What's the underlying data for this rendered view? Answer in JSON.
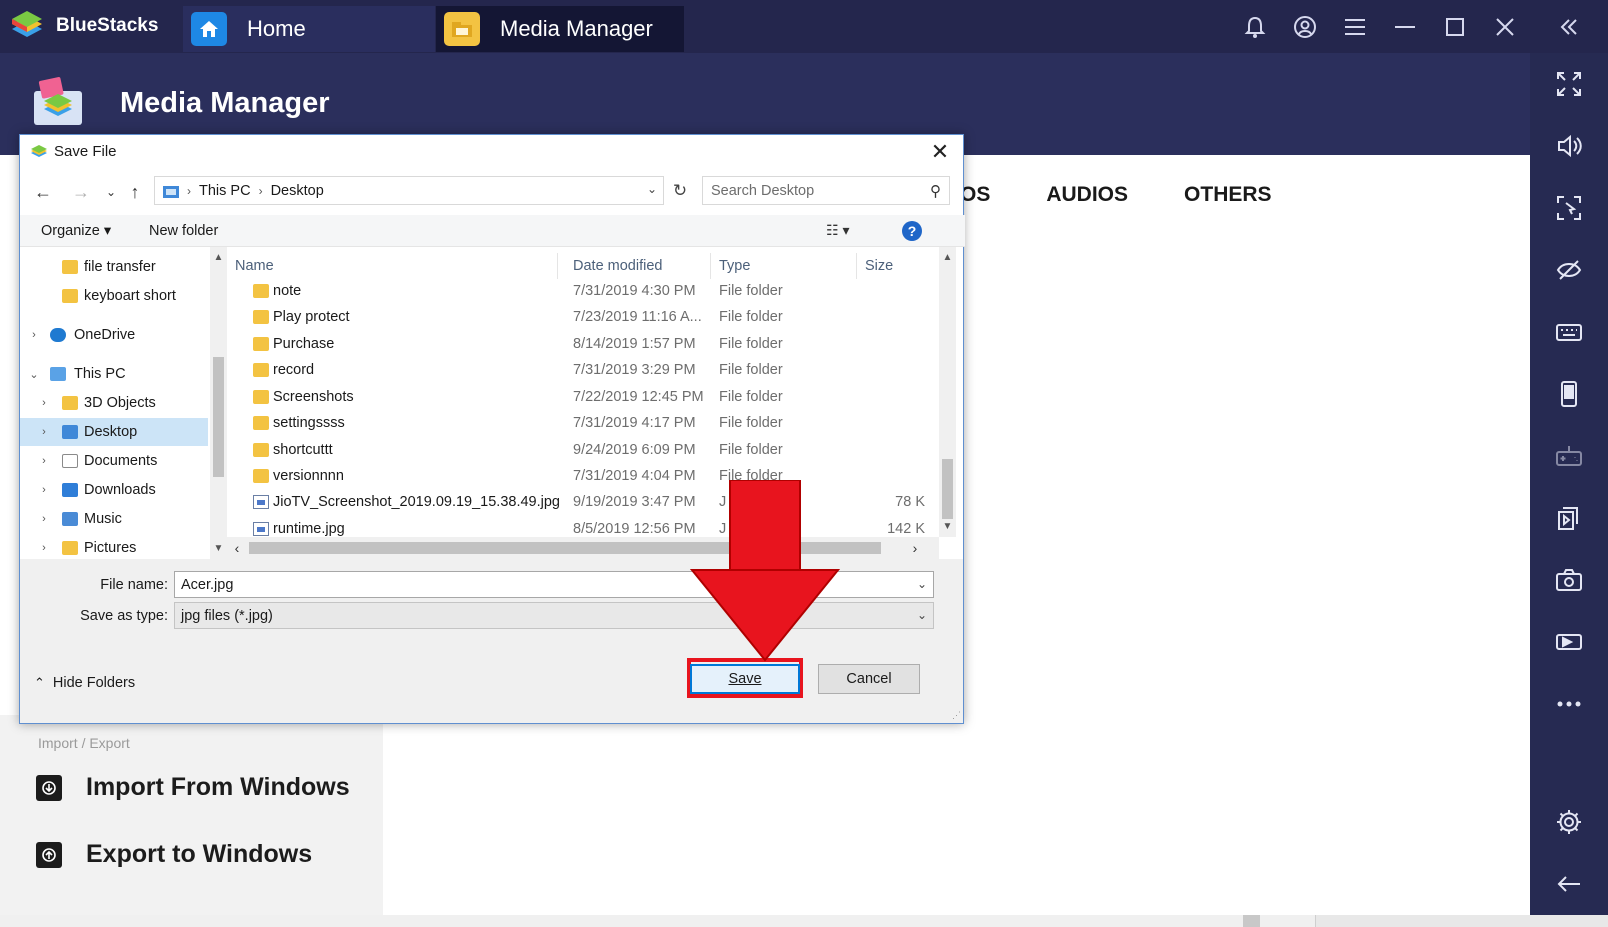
{
  "app": {
    "brand": "BlueStacks",
    "tabs": [
      {
        "label": "Home"
      },
      {
        "label": "Media Manager"
      }
    ]
  },
  "media_manager": {
    "title": "Media Manager",
    "category_tabs": [
      "OS",
      "AUDIOS",
      "OTHERS"
    ],
    "import_export_caption": "Import / Export",
    "import_label": "Import From Windows",
    "export_label": "Export to Windows"
  },
  "dialog": {
    "title": "Save File",
    "breadcrumb": [
      "This PC",
      "Desktop"
    ],
    "search_placeholder": "Search Desktop",
    "organize_label": "Organize",
    "new_folder_label": "New folder",
    "columns": {
      "name": "Name",
      "date": "Date modified",
      "type": "Type",
      "size": "Size"
    },
    "nav_tree": [
      {
        "label": "file transfer",
        "icon": "folder-icon",
        "level": 1
      },
      {
        "label": "keyboart short",
        "icon": "folder-icon",
        "level": 1
      },
      {
        "label": "OneDrive",
        "icon": "cloud-icon",
        "level": 0
      },
      {
        "label": "This PC",
        "icon": "computer-icon",
        "level": 0
      },
      {
        "label": "3D Objects",
        "icon": "folder-icon",
        "level": 1
      },
      {
        "label": "Desktop",
        "icon": "desktop-icon",
        "level": 1,
        "selected": true
      },
      {
        "label": "Documents",
        "icon": "documents-icon",
        "level": 1
      },
      {
        "label": "Downloads",
        "icon": "downloads-icon",
        "level": 1
      },
      {
        "label": "Music",
        "icon": "music-icon",
        "level": 1
      },
      {
        "label": "Pictures",
        "icon": "pictures-icon",
        "level": 1
      }
    ],
    "files": [
      {
        "name": "note",
        "date": "7/31/2019 4:30 PM",
        "type": "File folder",
        "size": "",
        "kind": "folder"
      },
      {
        "name": "Play protect",
        "date": "7/23/2019 11:16 A...",
        "type": "File folder",
        "size": "",
        "kind": "folder"
      },
      {
        "name": "Purchase",
        "date": "8/14/2019 1:57 PM",
        "type": "File folder",
        "size": "",
        "kind": "folder"
      },
      {
        "name": "record",
        "date": "7/31/2019 3:29 PM",
        "type": "File folder",
        "size": "",
        "kind": "folder"
      },
      {
        "name": "Screenshots",
        "date": "7/22/2019 12:45 PM",
        "type": "File folder",
        "size": "",
        "kind": "folder"
      },
      {
        "name": "settingssss",
        "date": "7/31/2019 4:17 PM",
        "type": "File folder",
        "size": "",
        "kind": "folder"
      },
      {
        "name": "shortcuttt",
        "date": "9/24/2019 6:09 PM",
        "type": "File folder",
        "size": "",
        "kind": "folder"
      },
      {
        "name": "versionnnn",
        "date": "7/31/2019 4:04 PM",
        "type": "File folder",
        "size": "",
        "kind": "folder"
      },
      {
        "name": "JioTV_Screenshot_2019.09.19_15.38.49.jpg",
        "date": "9/19/2019 3:47 PM",
        "type": "J",
        "size": "78 K",
        "kind": "image"
      },
      {
        "name": "runtime.jpg",
        "date": "8/5/2019 12:56 PM",
        "type": "J",
        "size": "142 K",
        "kind": "image"
      }
    ],
    "file_name_label": "File name:",
    "file_name_value": "Acer.jpg",
    "save_type_label": "Save as type:",
    "save_type_value": "jpg files (*.jpg)",
    "hide_folders_label": "Hide Folders",
    "save_label": "Save",
    "cancel_label": "Cancel"
  },
  "colors": {
    "titlebar": "#24264d",
    "header": "#2b2f5c",
    "sidebar": "#262a52",
    "selection": "#cce4f7",
    "annotation_red": "#e8141e",
    "accent_blue": "#0078d7"
  }
}
